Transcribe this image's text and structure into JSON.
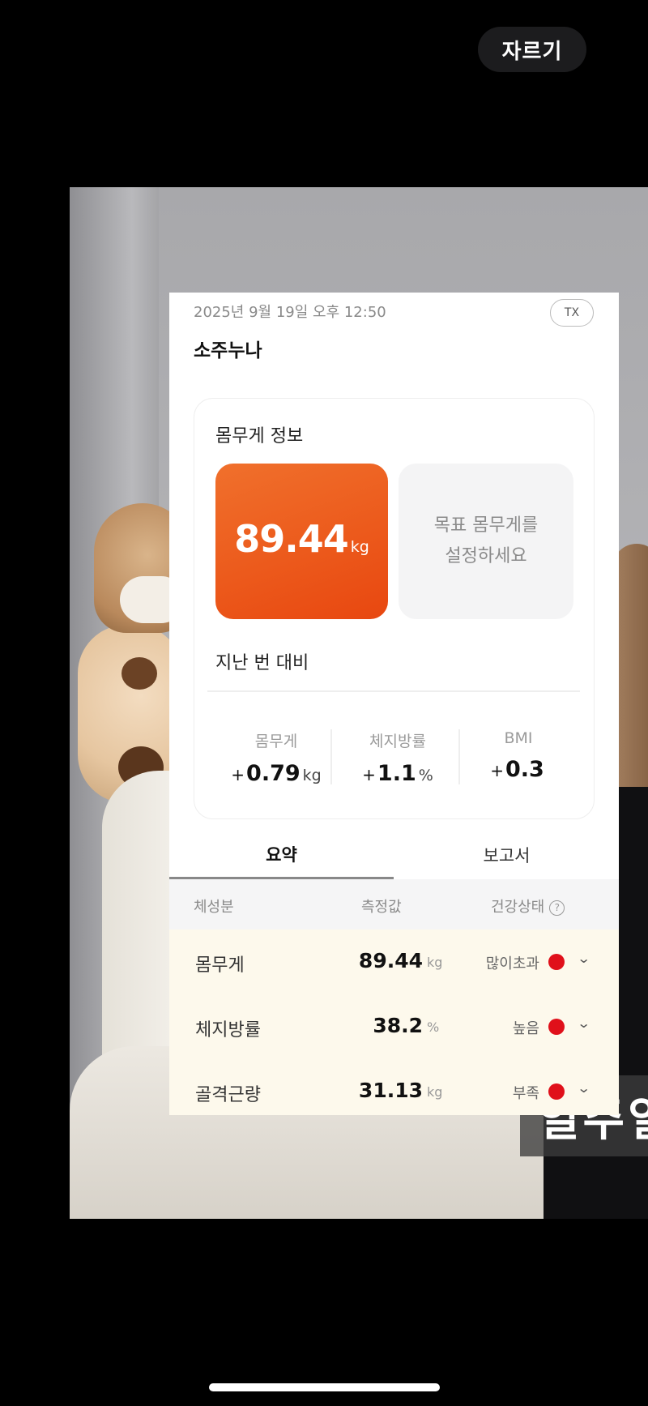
{
  "toolbar": {
    "crop_label": "자르기"
  },
  "app": {
    "date": "2025년 9월 19일 오후 12:50",
    "tx_label": "TX",
    "user_name": "소주누나",
    "weight_info": {
      "title": "몸무게 정보",
      "weight_value": "89.44",
      "weight_unit": "kg",
      "goal_line1": "목표 몸무게를",
      "goal_line2": "설정하세요"
    },
    "comparison": {
      "title": "지난 번 대비",
      "stats": [
        {
          "label": "몸무게",
          "sign": "+",
          "value": "0.79",
          "unit": "kg"
        },
        {
          "label": "체지방률",
          "sign": "+",
          "value": "1.1",
          "unit": "%"
        },
        {
          "label": "BMI",
          "sign": "+",
          "value": "0.3",
          "unit": ""
        }
      ]
    },
    "tabs": [
      {
        "label": "요약",
        "active": true
      },
      {
        "label": "보고서",
        "active": false
      }
    ],
    "table": {
      "headers": [
        "체성분",
        "측정값",
        "건강상태"
      ],
      "rows": [
        {
          "name": "몸무게",
          "value": "89.44",
          "unit": "kg",
          "status": "많이초과"
        },
        {
          "name": "체지방률",
          "value": "38.2",
          "unit": "%",
          "status": "높음"
        },
        {
          "name": "골격근량",
          "value": "31.13",
          "unit": "kg",
          "status": "부족"
        }
      ]
    }
  },
  "video_caption": "일주일",
  "colors": {
    "accent": "#ec5a1c",
    "status_red": "#e0101a",
    "table_bg": "#fdf9ec"
  }
}
